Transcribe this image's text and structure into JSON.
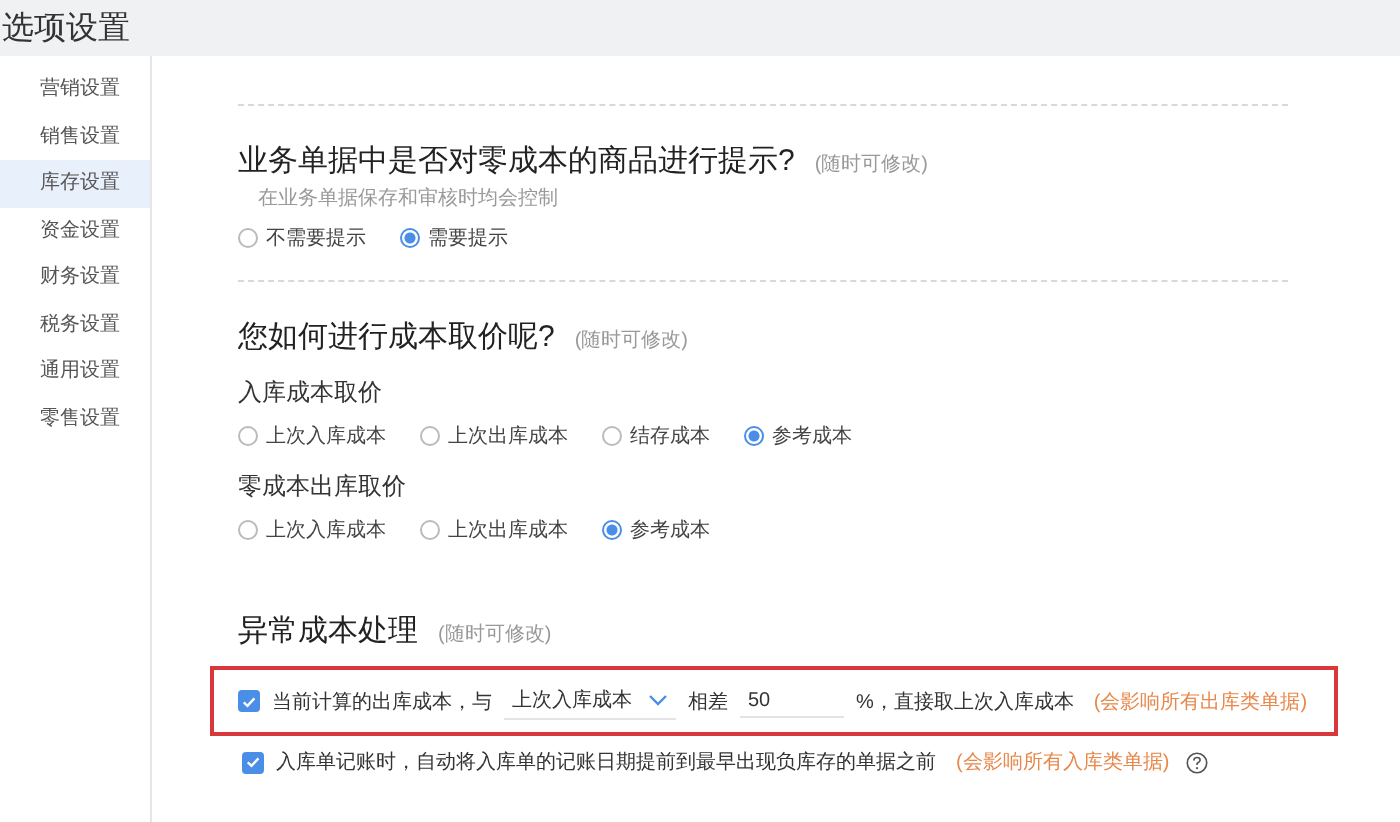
{
  "title": "选项设置",
  "sidebar": {
    "items": [
      {
        "label": "营销设置",
        "selected": false
      },
      {
        "label": "销售设置",
        "selected": false
      },
      {
        "label": "库存设置",
        "selected": true
      },
      {
        "label": "资金设置",
        "selected": false
      },
      {
        "label": "财务设置",
        "selected": false
      },
      {
        "label": "税务设置",
        "selected": false
      },
      {
        "label": "通用设置",
        "selected": false
      },
      {
        "label": "零售设置",
        "selected": false
      }
    ]
  },
  "sections": [
    {
      "title": "业务单据中是否对零成本的商品进行提示?",
      "note": "(随时可修改)",
      "hint": "在业务单据保存和审核时均会控制",
      "groups": [
        {
          "options": [
            {
              "label": "不需要提示",
              "selected": false
            },
            {
              "label": "需要提示",
              "selected": true
            }
          ]
        }
      ]
    },
    {
      "title": "您如何进行成本取价呢?",
      "note": "(随时可修改)",
      "groups": [
        {
          "label": "入库成本取价",
          "options": [
            {
              "label": "上次入库成本",
              "selected": false
            },
            {
              "label": "上次出库成本",
              "selected": false
            },
            {
              "label": "结存成本",
              "selected": false
            },
            {
              "label": "参考成本",
              "selected": true
            }
          ]
        },
        {
          "label": "零成本出库取价",
          "options": [
            {
              "label": "上次入库成本",
              "selected": false
            },
            {
              "label": "上次出库成本",
              "selected": false
            },
            {
              "label": "参考成本",
              "selected": true
            }
          ]
        }
      ]
    }
  ],
  "abnormal": {
    "title": "异常成本处理",
    "note": "(随时可修改)",
    "rows": [
      {
        "kind": "compare",
        "checked": true,
        "highlighted": true,
        "text_before": "当前计算的出库成本，与",
        "select": "上次入库成本",
        "text_middle": "相差",
        "value": "50",
        "text_after": "%，直接取上次入库成本",
        "warning": "(会影响所有出库类单据)"
      },
      {
        "kind": "plain",
        "checked": true,
        "highlighted": false,
        "text": "入库单记账时，自动将入库单的记账日期提前到最早出现负库存的单据之前",
        "warning": "(会影响所有入库类单据)",
        "help": true
      }
    ]
  }
}
